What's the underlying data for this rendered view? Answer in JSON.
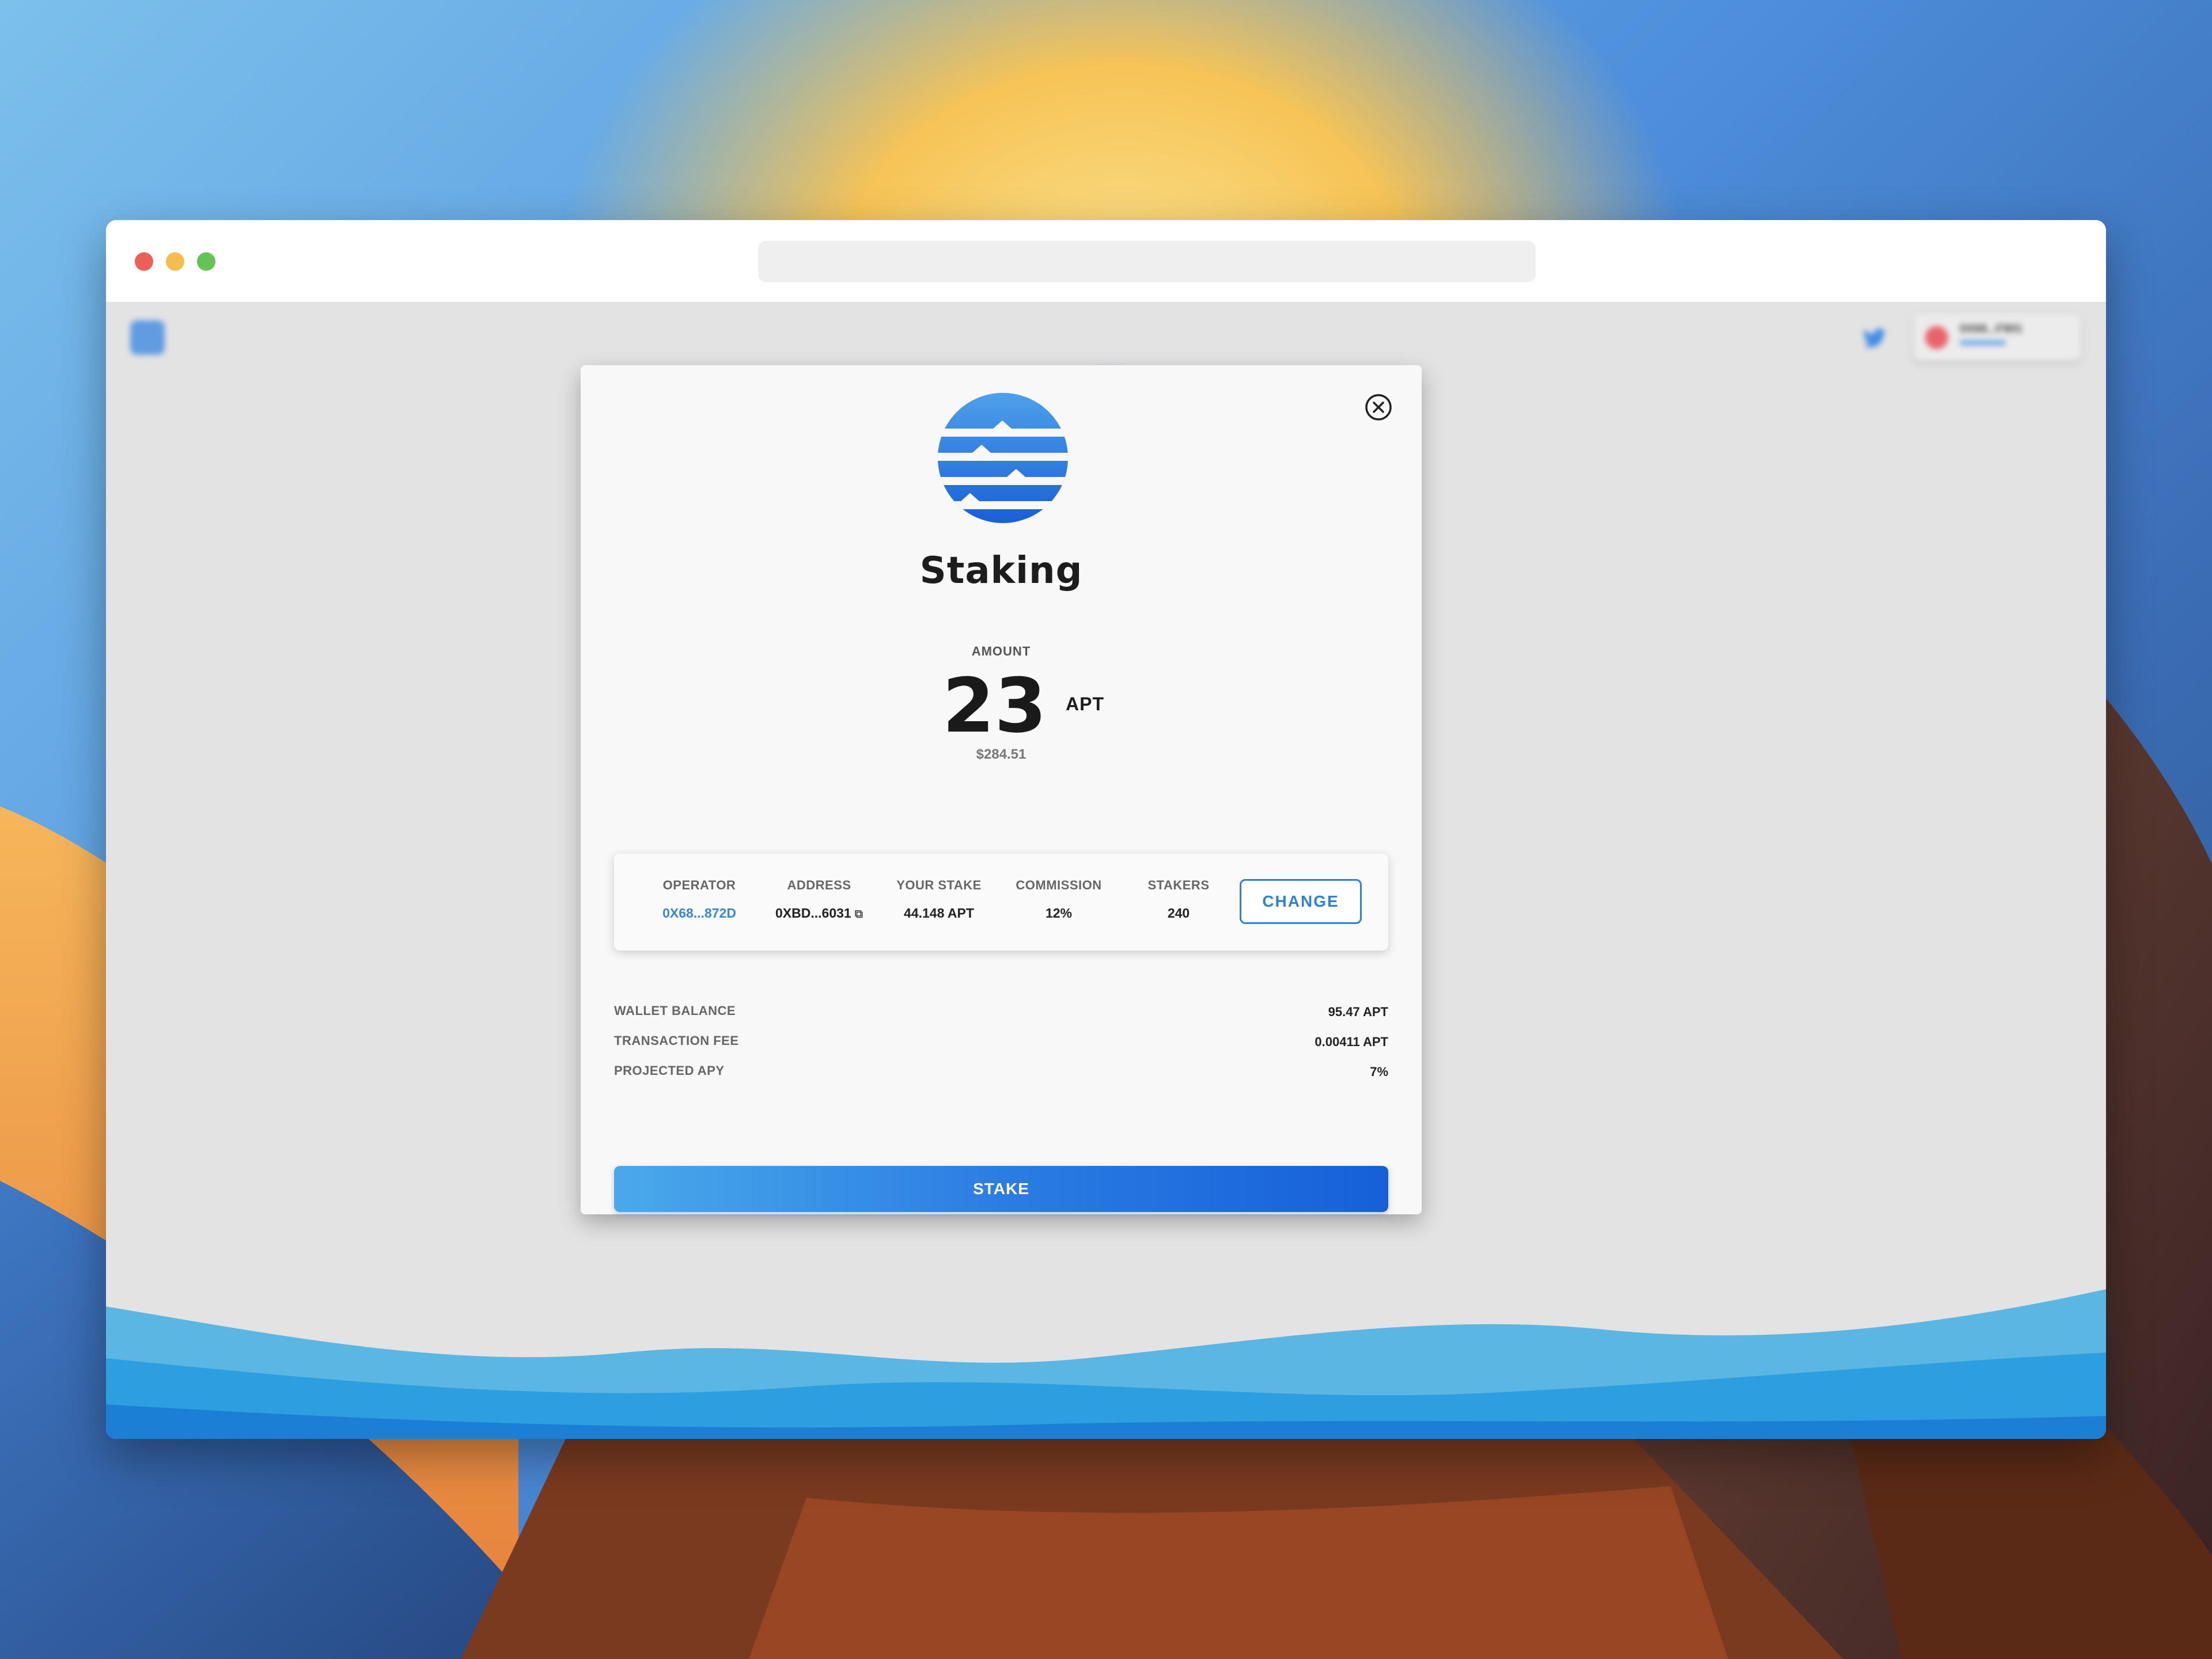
{
  "modal": {
    "title": "Staking",
    "amount_label": "AMOUNT",
    "amount_value": "23",
    "amount_unit": "APT",
    "amount_usd": "$284.51",
    "validator": {
      "columns": [
        {
          "header": "OPERATOR",
          "value": "0X68...872D"
        },
        {
          "header": "ADDRESS",
          "value": "0XBD...6031"
        },
        {
          "header": "YOUR STAKE",
          "value": "44.148 APT"
        },
        {
          "header": "COMMISSION",
          "value": "12%"
        },
        {
          "header": "STAKERS",
          "value": "240"
        }
      ],
      "change_label": "CHANGE"
    },
    "summary": [
      {
        "label": "WALLET BALANCE",
        "value": "95.47 APT"
      },
      {
        "label": "TRANSACTION FEE",
        "value": "0.00411 APT"
      },
      {
        "label": "PROJECTED APY",
        "value": "7%"
      }
    ],
    "stake_label": "STAKE"
  },
  "header": {
    "wallet_address": "0X68...F901"
  },
  "icons": {
    "close": "close-circle-icon",
    "copy": "copy-icon",
    "coin": "aptos-logo-icon",
    "twitter": "twitter-icon"
  },
  "colors": {
    "accent": "#2f80d8",
    "stake_gradient_start": "#4aa9ea",
    "stake_gradient_end": "#1560d8"
  }
}
